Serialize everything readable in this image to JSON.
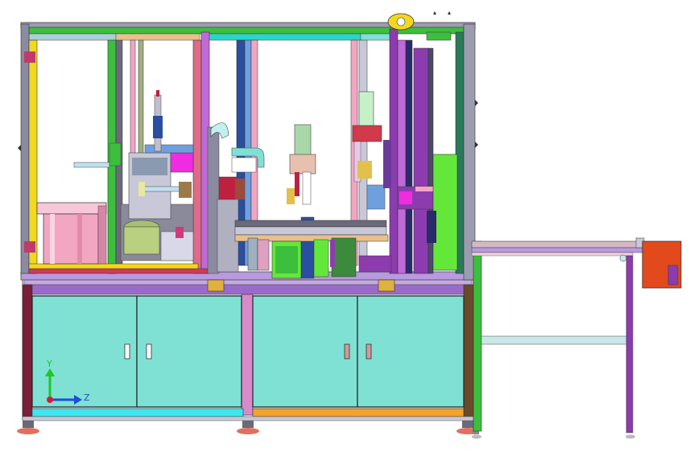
{
  "view_triad": {
    "y_label": "Y",
    "z_label": "Z",
    "y_color": "#1ec81e",
    "z_color": "#1a4fd6",
    "origin_color": "#d21c3a"
  },
  "colors": {
    "background": "#ffffff",
    "frame_outline": "#5a5a6a",
    "cabinet_door": "#7fe0d4",
    "cabinet_door_dark": "#5ec3b8",
    "conveyor": "#d7b8c2",
    "hopper": "#f2a6c2",
    "reject_box": "#e24a1c",
    "green_panel": "#63e83a",
    "magenta_block": "#f02ce0",
    "purple_rail": "#8c3cae",
    "yellow_rail": "#f2d81e",
    "cyan_rail": "#2ad6c8",
    "green_rail": "#3cbf3c",
    "orange_strip": "#f4a22a",
    "cyan_strip": "#3ee6f0"
  }
}
